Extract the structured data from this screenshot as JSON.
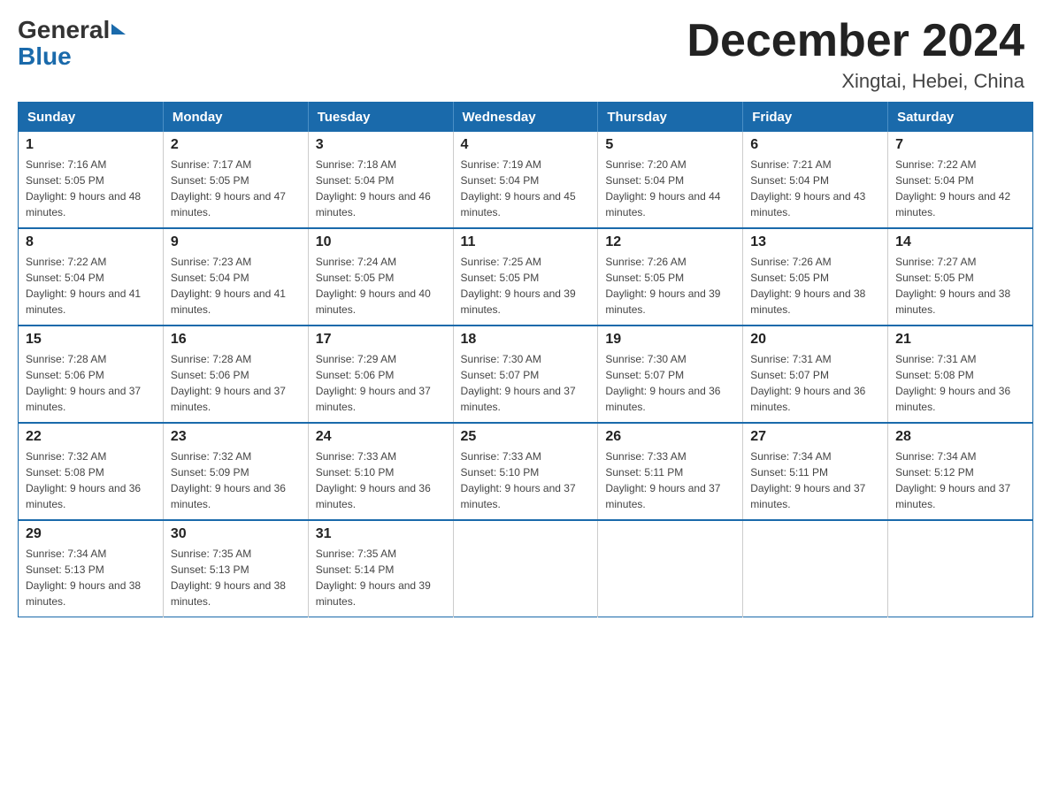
{
  "header": {
    "month_title": "December 2024",
    "location": "Xingtai, Hebei, China",
    "logo_general": "General",
    "logo_blue": "Blue"
  },
  "calendar": {
    "days_of_week": [
      "Sunday",
      "Monday",
      "Tuesday",
      "Wednesday",
      "Thursday",
      "Friday",
      "Saturday"
    ],
    "weeks": [
      [
        {
          "day": "1",
          "sunrise": "7:16 AM",
          "sunset": "5:05 PM",
          "daylight": "9 hours and 48 minutes."
        },
        {
          "day": "2",
          "sunrise": "7:17 AM",
          "sunset": "5:05 PM",
          "daylight": "9 hours and 47 minutes."
        },
        {
          "day": "3",
          "sunrise": "7:18 AM",
          "sunset": "5:04 PM",
          "daylight": "9 hours and 46 minutes."
        },
        {
          "day": "4",
          "sunrise": "7:19 AM",
          "sunset": "5:04 PM",
          "daylight": "9 hours and 45 minutes."
        },
        {
          "day": "5",
          "sunrise": "7:20 AM",
          "sunset": "5:04 PM",
          "daylight": "9 hours and 44 minutes."
        },
        {
          "day": "6",
          "sunrise": "7:21 AM",
          "sunset": "5:04 PM",
          "daylight": "9 hours and 43 minutes."
        },
        {
          "day": "7",
          "sunrise": "7:22 AM",
          "sunset": "5:04 PM",
          "daylight": "9 hours and 42 minutes."
        }
      ],
      [
        {
          "day": "8",
          "sunrise": "7:22 AM",
          "sunset": "5:04 PM",
          "daylight": "9 hours and 41 minutes."
        },
        {
          "day": "9",
          "sunrise": "7:23 AM",
          "sunset": "5:04 PM",
          "daylight": "9 hours and 41 minutes."
        },
        {
          "day": "10",
          "sunrise": "7:24 AM",
          "sunset": "5:05 PM",
          "daylight": "9 hours and 40 minutes."
        },
        {
          "day": "11",
          "sunrise": "7:25 AM",
          "sunset": "5:05 PM",
          "daylight": "9 hours and 39 minutes."
        },
        {
          "day": "12",
          "sunrise": "7:26 AM",
          "sunset": "5:05 PM",
          "daylight": "9 hours and 39 minutes."
        },
        {
          "day": "13",
          "sunrise": "7:26 AM",
          "sunset": "5:05 PM",
          "daylight": "9 hours and 38 minutes."
        },
        {
          "day": "14",
          "sunrise": "7:27 AM",
          "sunset": "5:05 PM",
          "daylight": "9 hours and 38 minutes."
        }
      ],
      [
        {
          "day": "15",
          "sunrise": "7:28 AM",
          "sunset": "5:06 PM",
          "daylight": "9 hours and 37 minutes."
        },
        {
          "day": "16",
          "sunrise": "7:28 AM",
          "sunset": "5:06 PM",
          "daylight": "9 hours and 37 minutes."
        },
        {
          "day": "17",
          "sunrise": "7:29 AM",
          "sunset": "5:06 PM",
          "daylight": "9 hours and 37 minutes."
        },
        {
          "day": "18",
          "sunrise": "7:30 AM",
          "sunset": "5:07 PM",
          "daylight": "9 hours and 37 minutes."
        },
        {
          "day": "19",
          "sunrise": "7:30 AM",
          "sunset": "5:07 PM",
          "daylight": "9 hours and 36 minutes."
        },
        {
          "day": "20",
          "sunrise": "7:31 AM",
          "sunset": "5:07 PM",
          "daylight": "9 hours and 36 minutes."
        },
        {
          "day": "21",
          "sunrise": "7:31 AM",
          "sunset": "5:08 PM",
          "daylight": "9 hours and 36 minutes."
        }
      ],
      [
        {
          "day": "22",
          "sunrise": "7:32 AM",
          "sunset": "5:08 PM",
          "daylight": "9 hours and 36 minutes."
        },
        {
          "day": "23",
          "sunrise": "7:32 AM",
          "sunset": "5:09 PM",
          "daylight": "9 hours and 36 minutes."
        },
        {
          "day": "24",
          "sunrise": "7:33 AM",
          "sunset": "5:10 PM",
          "daylight": "9 hours and 36 minutes."
        },
        {
          "day": "25",
          "sunrise": "7:33 AM",
          "sunset": "5:10 PM",
          "daylight": "9 hours and 37 minutes."
        },
        {
          "day": "26",
          "sunrise": "7:33 AM",
          "sunset": "5:11 PM",
          "daylight": "9 hours and 37 minutes."
        },
        {
          "day": "27",
          "sunrise": "7:34 AM",
          "sunset": "5:11 PM",
          "daylight": "9 hours and 37 minutes."
        },
        {
          "day": "28",
          "sunrise": "7:34 AM",
          "sunset": "5:12 PM",
          "daylight": "9 hours and 37 minutes."
        }
      ],
      [
        {
          "day": "29",
          "sunrise": "7:34 AM",
          "sunset": "5:13 PM",
          "daylight": "9 hours and 38 minutes."
        },
        {
          "day": "30",
          "sunrise": "7:35 AM",
          "sunset": "5:13 PM",
          "daylight": "9 hours and 38 minutes."
        },
        {
          "day": "31",
          "sunrise": "7:35 AM",
          "sunset": "5:14 PM",
          "daylight": "9 hours and 39 minutes."
        },
        null,
        null,
        null,
        null
      ]
    ]
  }
}
